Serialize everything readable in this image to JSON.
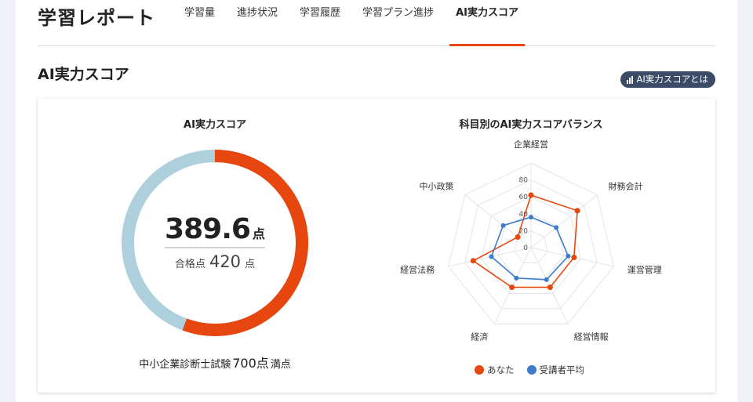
{
  "header": {
    "title": "学習レポート",
    "tabs": [
      {
        "label": "学習量",
        "active": false
      },
      {
        "label": "進捗状況",
        "active": false
      },
      {
        "label": "学習履歴",
        "active": false
      },
      {
        "label": "学習プラン進捗",
        "active": false
      },
      {
        "label": "AI実力スコア",
        "active": true
      }
    ]
  },
  "section": {
    "title": "AI実力スコア",
    "about_button": "AI実力スコアとは"
  },
  "colors": {
    "accent": "#e8460f",
    "remainder": "#aecfdc",
    "average": "#3a7cc9",
    "button": "#3b4a66"
  },
  "score": {
    "title": "AI実力スコア",
    "value": "389.6",
    "unit": "点",
    "pass_label": "合格点",
    "pass_value": "420",
    "pass_unit": "点",
    "max_score": 700,
    "exam_name": "中小企業診断士試験",
    "exam_max": "700点",
    "exam_suffix": "満点"
  },
  "chart_data": {
    "type": "radar",
    "title": "科目別のAI実力スコアバランス",
    "categories": [
      "企業経営",
      "財務会計",
      "運営管理",
      "経営情報",
      "経済",
      "経営法務",
      "中小政策"
    ],
    "rlim": [
      0,
      100
    ],
    "ticks": [
      "0",
      "20",
      "40",
      "60",
      "80"
    ],
    "series": [
      {
        "name": "あなた",
        "values": [
          62,
          70,
          52,
          52,
          52,
          70,
          20
        ]
      },
      {
        "name": "受講者平均",
        "values": [
          36,
          38,
          45,
          42,
          40,
          48,
          42
        ]
      }
    ]
  }
}
